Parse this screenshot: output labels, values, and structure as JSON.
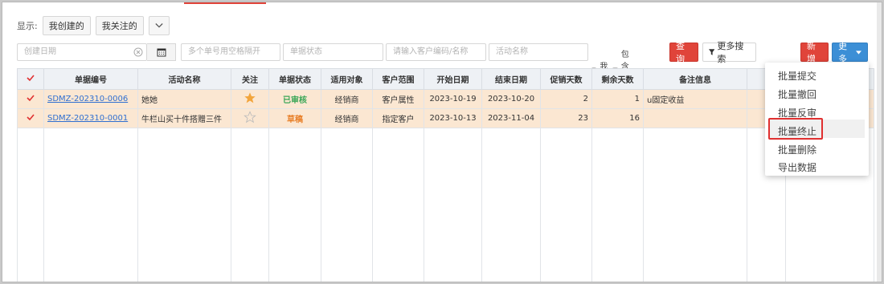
{
  "filter": {
    "display_label": "显示:",
    "mine_label": "我创建的",
    "follow_label": "我关注的"
  },
  "search": {
    "create_date_ph": "创建日期",
    "order_no_ph": "多个单号用空格隔开",
    "status_ph": "单据状态",
    "customer_ph": "请输入客户编码/名称",
    "activity_ph": "活动名称",
    "mine_check": "我的",
    "include_end_check": "包含结束",
    "query_btn": "查询",
    "more_search_btn": "更多搜索",
    "add_btn": "新增",
    "more_btn": "更多"
  },
  "table": {
    "headers": [
      "单据编号",
      "活动名称",
      "关注",
      "单据状态",
      "适用对象",
      "客户范围",
      "开始日期",
      "结束日期",
      "促销天数",
      "剩余天数",
      "备注信息"
    ],
    "rows": [
      {
        "code": "SDMZ-202310-0006",
        "name": "她她",
        "starred": true,
        "status": "已审核",
        "status_color": "#3aa657",
        "target": "经销商",
        "scope": "客户属性",
        "start": "2023-10-19",
        "end": "2023-10-20",
        "days": "2",
        "remaining": "1",
        "remark": "u固定收益"
      },
      {
        "code": "SDMZ-202310-0001",
        "name": "牛栏山买十件搭赠三件",
        "starred": false,
        "status": "草稿",
        "status_color": "#e8802a",
        "target": "经销商",
        "scope": "指定客户",
        "start": "2023-10-13",
        "end": "2023-11-04",
        "days": "23",
        "remaining": "16",
        "remark": ""
      }
    ]
  },
  "menu": {
    "items": [
      "批量提交",
      "批量撤回",
      "批量反审",
      "批量终止",
      "批量删除",
      "导出数据"
    ],
    "highlighted": "批量终止"
  },
  "colors": {
    "accent_red": "#e0443a",
    "accent_blue": "#3c8fd6",
    "selected_row": "#fbe7d2",
    "star": "#f2a53c"
  }
}
